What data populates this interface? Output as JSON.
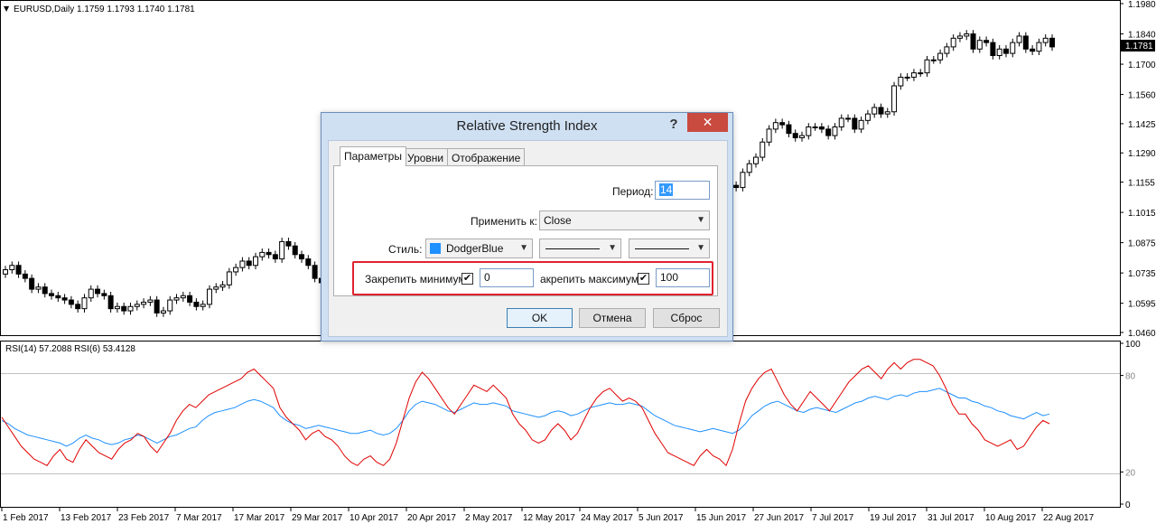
{
  "symbol_info": "EURUSD,Daily  1.1759 1.1793 1.1740 1.1781",
  "current_price_label": "1.1781",
  "price_axis_labels": [
    "1.1980",
    "1.1840",
    "1.1700",
    "1.1560",
    "1.1425",
    "1.1290",
    "1.1155",
    "1.1015",
    "1.0875",
    "1.0735",
    "1.0595",
    "1.0460"
  ],
  "rsi_info": "RSI(14) 57.2088  RSI(6) 53.4128",
  "rsi_axis_labels": [
    "100",
    "80",
    "20",
    "0"
  ],
  "date_labels": [
    "1 Feb 2017",
    "13 Feb 2017",
    "23 Feb 2017",
    "7 Mar 2017",
    "17 Mar 2017",
    "29 Mar 2017",
    "10 Apr 2017",
    "20 Apr 2017",
    "2 May 2017",
    "12 May 2017",
    "24 May 2017",
    "5 Jun 2017",
    "15 Jun 2017",
    "27 Jun 2017",
    "7 Jul 2017",
    "19 Jul 2017",
    "31 Jul 2017",
    "10 Aug 2017",
    "22 Aug 2017"
  ],
  "colors": {
    "bull_body": "#ffffff",
    "bear_body": "#000000",
    "rsi14": "#1e90ff",
    "rsi6": "#e00000",
    "level_line": "#c0c0c0"
  },
  "chart_data": {
    "type": "candlestick",
    "title": "EURUSD,Daily",
    "ylim": [
      1.046,
      1.198
    ],
    "closes": [
      1.075,
      1.077,
      1.073,
      1.071,
      1.066,
      1.067,
      1.064,
      1.063,
      1.062,
      1.061,
      1.059,
      1.057,
      1.062,
      1.066,
      1.064,
      1.063,
      1.057,
      1.058,
      1.056,
      1.058,
      1.059,
      1.06,
      1.061,
      1.055,
      1.056,
      1.061,
      1.062,
      1.063,
      1.06,
      1.058,
      1.059,
      1.066,
      1.067,
      1.068,
      1.074,
      1.076,
      1.079,
      1.077,
      1.081,
      1.083,
      1.082,
      1.08,
      1.088,
      1.086,
      1.082,
      1.08,
      1.077,
      1.071,
      1.069,
      1.07,
      1.07,
      1.068,
      1.066,
      1.064,
      1.064,
      1.065,
      1.066,
      1.063,
      1.062,
      1.061,
      1.062,
      1.064,
      1.066,
      1.064,
      1.063,
      1.062,
      1.066,
      1.071,
      1.085,
      1.087,
      1.089,
      1.092,
      1.093,
      1.094,
      1.092,
      1.09,
      1.088,
      1.092,
      1.097,
      1.102,
      1.104,
      1.111,
      1.115,
      1.117,
      1.116,
      1.12,
      1.119,
      1.121,
      1.119,
      1.118,
      1.121,
      1.122,
      1.123,
      1.122,
      1.125,
      1.126,
      1.124,
      1.12,
      1.121,
      1.119,
      1.117,
      1.118,
      1.116,
      1.118,
      1.114,
      1.116,
      1.117,
      1.116,
      1.118,
      1.116,
      1.114,
      1.113,
      1.12,
      1.124,
      1.127,
      1.134,
      1.14,
      1.143,
      1.142,
      1.138,
      1.136,
      1.137,
      1.141,
      1.141,
      1.14,
      1.137,
      1.141,
      1.145,
      1.145,
      1.14,
      1.144,
      1.147,
      1.15,
      1.147,
      1.148,
      1.16,
      1.164,
      1.164,
      1.166,
      1.166,
      1.172,
      1.172,
      1.175,
      1.178,
      1.182,
      1.183,
      1.184,
      1.177,
      1.181,
      1.18,
      1.174,
      1.177,
      1.175,
      1.18,
      1.183,
      1.177,
      1.176,
      1.18,
      1.182,
      1.178
    ],
    "opens": [
      1.073,
      1.075,
      1.077,
      1.073,
      1.071,
      1.066,
      1.067,
      1.064,
      1.063,
      1.062,
      1.061,
      1.059,
      1.057,
      1.062,
      1.066,
      1.064,
      1.063,
      1.057,
      1.058,
      1.056,
      1.058,
      1.059,
      1.06,
      1.061,
      1.055,
      1.056,
      1.061,
      1.062,
      1.063,
      1.06,
      1.058,
      1.059,
      1.066,
      1.067,
      1.068,
      1.074,
      1.076,
      1.079,
      1.077,
      1.081,
      1.083,
      1.082,
      1.08,
      1.088,
      1.086,
      1.082,
      1.08,
      1.077,
      1.071,
      1.069,
      1.07,
      1.07,
      1.068,
      1.066,
      1.064,
      1.064,
      1.065,
      1.066,
      1.063,
      1.062,
      1.061,
      1.062,
      1.064,
      1.066,
      1.064,
      1.063,
      1.062,
      1.066,
      1.071,
      1.085,
      1.087,
      1.089,
      1.092,
      1.093,
      1.094,
      1.092,
      1.09,
      1.088,
      1.092,
      1.097,
      1.102,
      1.104,
      1.111,
      1.115,
      1.117,
      1.116,
      1.12,
      1.119,
      1.121,
      1.119,
      1.118,
      1.121,
      1.122,
      1.123,
      1.122,
      1.125,
      1.126,
      1.124,
      1.12,
      1.121,
      1.119,
      1.117,
      1.118,
      1.116,
      1.118,
      1.114,
      1.116,
      1.117,
      1.116,
      1.118,
      1.116,
      1.114,
      1.113,
      1.12,
      1.124,
      1.127,
      1.134,
      1.14,
      1.143,
      1.142,
      1.138,
      1.136,
      1.137,
      1.141,
      1.141,
      1.14,
      1.137,
      1.141,
      1.145,
      1.145,
      1.14,
      1.144,
      1.147,
      1.15,
      1.147,
      1.148,
      1.16,
      1.164,
      1.164,
      1.166,
      1.166,
      1.172,
      1.172,
      1.175,
      1.178,
      1.182,
      1.183,
      1.184,
      1.177,
      1.181,
      1.18,
      1.174,
      1.177,
      1.175,
      1.18,
      1.183,
      1.177,
      1.176,
      1.18,
      1.182
    ],
    "rsi_ylim": [
      0,
      100
    ],
    "rsi_levels": [
      20,
      80
    ],
    "rsi14": [
      52,
      50,
      47,
      45,
      43,
      42,
      41,
      40,
      39,
      38,
      36,
      38,
      41,
      43,
      41,
      40,
      38,
      37,
      38,
      40,
      41,
      43,
      42,
      40,
      38,
      40,
      42,
      43,
      45,
      47,
      48,
      52,
      55,
      57,
      58,
      59,
      60,
      62,
      64,
      65,
      64,
      62,
      60,
      55,
      52,
      50,
      49,
      47,
      48,
      49,
      48,
      47,
      46,
      45,
      44,
      44,
      45,
      46,
      44,
      43,
      44,
      47,
      52,
      58,
      62,
      64,
      63,
      62,
      60,
      58,
      57,
      59,
      61,
      63,
      62,
      62,
      63,
      62,
      61,
      58,
      57,
      56,
      55,
      54,
      55,
      57,
      58,
      57,
      55,
      56,
      58,
      60,
      61,
      62,
      63,
      62,
      62,
      63,
      62,
      61,
      58,
      55,
      53,
      51,
      49,
      48,
      47,
      46,
      45,
      46,
      47,
      46,
      45,
      44,
      46,
      50,
      55,
      58,
      61,
      63,
      64,
      62,
      60,
      58,
      57,
      59,
      60,
      59,
      58,
      57,
      59,
      61,
      63,
      64,
      66,
      67,
      66,
      65,
      67,
      68,
      67,
      69,
      70,
      70,
      71,
      72,
      70,
      68,
      66,
      66,
      64,
      63,
      61,
      60,
      58,
      57,
      55,
      54,
      53,
      55,
      57,
      55,
      56
    ],
    "rsi6": [
      54,
      48,
      42,
      36,
      32,
      28,
      26,
      24,
      30,
      34,
      28,
      26,
      34,
      40,
      36,
      32,
      30,
      28,
      34,
      38,
      40,
      44,
      42,
      36,
      32,
      38,
      44,
      52,
      58,
      62,
      60,
      64,
      68,
      70,
      72,
      74,
      76,
      78,
      82,
      84,
      80,
      76,
      72,
      60,
      54,
      50,
      46,
      40,
      44,
      46,
      42,
      40,
      36,
      30,
      26,
      24,
      28,
      30,
      26,
      24,
      28,
      38,
      52,
      66,
      76,
      82,
      78,
      72,
      66,
      60,
      56,
      62,
      68,
      74,
      72,
      70,
      74,
      70,
      66,
      56,
      50,
      46,
      40,
      38,
      40,
      46,
      50,
      46,
      40,
      44,
      52,
      60,
      66,
      70,
      72,
      68,
      64,
      66,
      64,
      60,
      52,
      44,
      38,
      32,
      30,
      28,
      26,
      24,
      30,
      34,
      30,
      28,
      24,
      34,
      50,
      64,
      72,
      78,
      82,
      84,
      76,
      68,
      62,
      58,
      64,
      70,
      66,
      62,
      58,
      64,
      70,
      76,
      80,
      84,
      86,
      82,
      78,
      84,
      88,
      84,
      88,
      90,
      90,
      88,
      86,
      80,
      72,
      62,
      56,
      56,
      50,
      46,
      40,
      38,
      36,
      38,
      40,
      34,
      36,
      42,
      48,
      52,
      50
    ]
  },
  "dialog": {
    "title": "Relative Strength Index",
    "help_label": "?",
    "close_label": "✕",
    "tabs": [
      "Параметры",
      "Уровни",
      "Отображение"
    ],
    "period_label": "Период:",
    "period_value": "14",
    "apply_label": "Применить к:",
    "apply_value": "Close",
    "style_label": "Стиль:",
    "style_color": "DodgerBlue",
    "fix_min_label": "Закрепить минимум",
    "fix_min_value": "0",
    "fix_max_label": "акрепить максимум",
    "fix_max_value": "100",
    "ok_label": "OK",
    "cancel_label": "Отмена",
    "reset_label": "Сброс"
  }
}
